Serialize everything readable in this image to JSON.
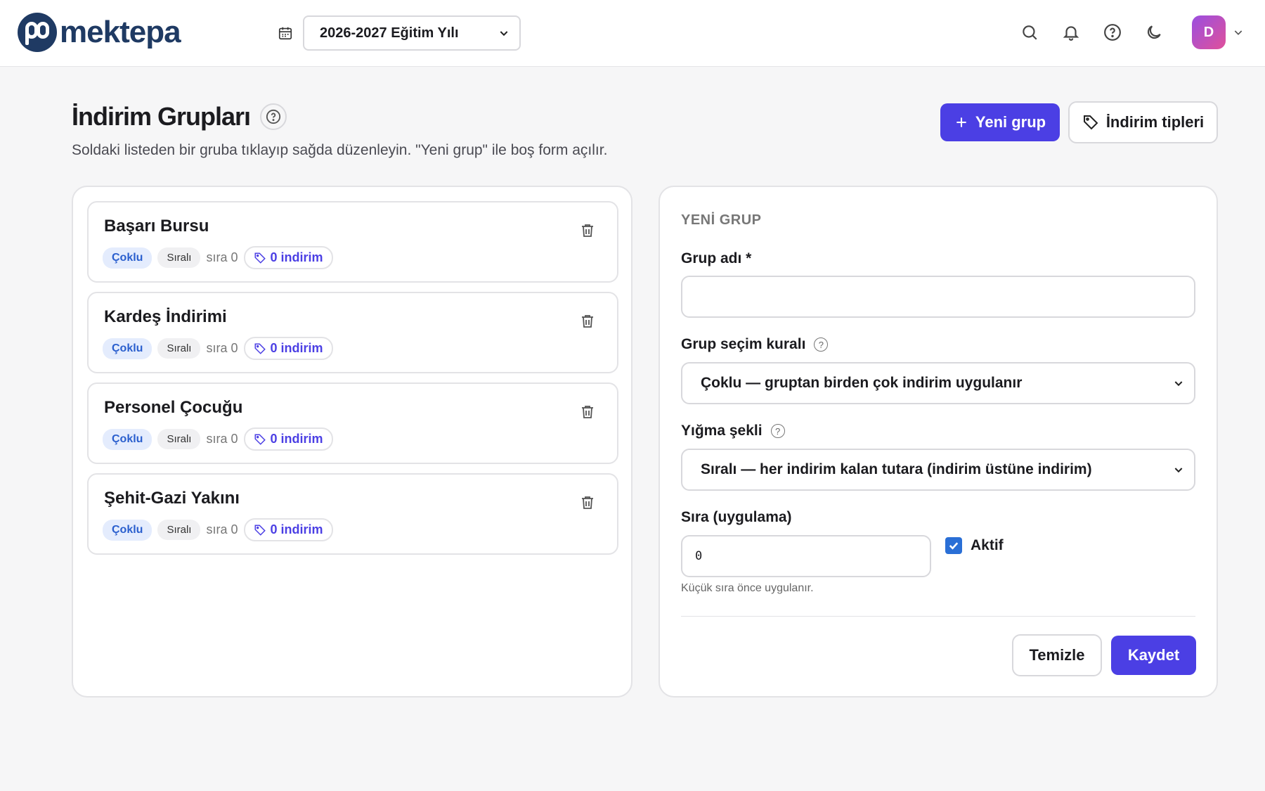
{
  "header": {
    "logo_text": "mektepa",
    "year_select": "2026-2027 Eğitim Yılı",
    "avatar_initial": "D",
    "icons": [
      "calendar-icon",
      "search-icon",
      "bell-icon",
      "help-icon",
      "moon-icon",
      "chevron-down-icon"
    ]
  },
  "page": {
    "title": "İndirim Grupları",
    "subtitle": "Soldaki listeden bir gruba tıklayıp sağda düzenleyin. \"Yeni grup\" ile boş form açılır.",
    "new_group_button": "Yeni grup",
    "discount_types_button": "İndirim tipleri"
  },
  "groups": [
    {
      "name": "Başarı Bursu",
      "tag_rule": "Çoklu",
      "tag_stack": "Sıralı",
      "order": "sıra 0",
      "count": "0 indirim"
    },
    {
      "name": "Kardeş İndirimi",
      "tag_rule": "Çoklu",
      "tag_stack": "Sıralı",
      "order": "sıra 0",
      "count": "0 indirim"
    },
    {
      "name": "Personel Çocuğu",
      "tag_rule": "Çoklu",
      "tag_stack": "Sıralı",
      "order": "sıra 0",
      "count": "0 indirim"
    },
    {
      "name": "Şehit-Gazi Yakını",
      "tag_rule": "Çoklu",
      "tag_stack": "Sıralı",
      "order": "sıra 0",
      "count": "0 indirim"
    }
  ],
  "form": {
    "heading": "YENİ GRUP",
    "name_label": "Grup adı *",
    "name_value": "",
    "rule_label": "Grup seçim kuralı",
    "rule_value": "Çoklu — gruptan birden çok indirim uygulanır",
    "stack_label": "Yığma şekli",
    "stack_value": "Sıralı — her indirim kalan tutara (indirim üstüne indirim)",
    "order_label": "Sıra (uygulama)",
    "order_value": "0",
    "active_label": "Aktif",
    "active_checked": true,
    "order_hint": "Küçük sıra önce uygulanır.",
    "clear_button": "Temizle",
    "save_button": "Kaydet"
  },
  "colors": {
    "primary": "#4b3fe4",
    "logo": "#1f3a63",
    "tag_blue_bg": "#e4ecfd",
    "tag_blue_text": "#2a5fce"
  }
}
